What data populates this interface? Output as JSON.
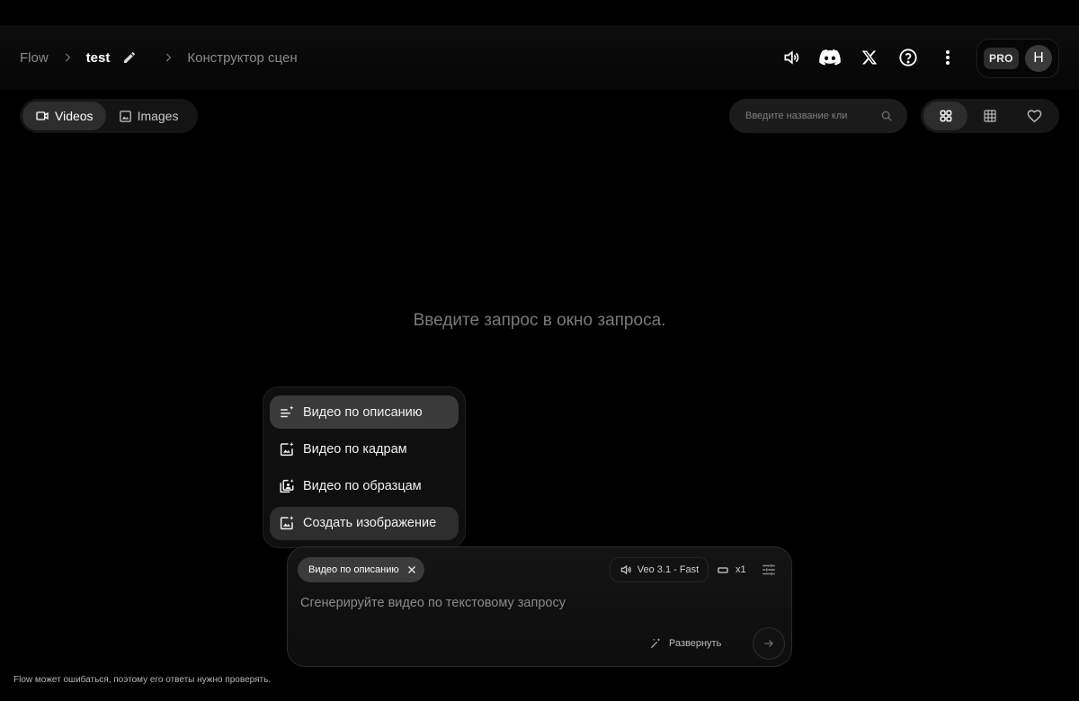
{
  "breadcrumb": {
    "root": "Flow",
    "project": "test",
    "current": "Конструктор сцен"
  },
  "header": {
    "icons": [
      "volume-icon",
      "discord-icon",
      "x-logo-icon",
      "help-icon",
      "more-vert-icon"
    ],
    "plan_badge": "PRO",
    "avatar_initial": "H"
  },
  "media_tabs": [
    {
      "label": "Videos",
      "icon": "videocam-icon",
      "active": true
    },
    {
      "label": "Images",
      "icon": "image-icon",
      "active": false
    }
  ],
  "search": {
    "placeholder": "Введите название кли"
  },
  "view_modes": [
    "grid-large-icon",
    "grid-small-icon",
    "favorite-icon"
  ],
  "empty_state": "Введите запрос в окно запроса.",
  "mode_menu": {
    "items": [
      {
        "label": "Видео по описанию",
        "icon": "text-sparkle-icon",
        "state": "active"
      },
      {
        "label": "Видео по кадрам",
        "icon": "image-sparkle-icon",
        "state": ""
      },
      {
        "label": "Видео по образцам",
        "icon": "ingredients-sparkle-icon",
        "state": ""
      },
      {
        "label": "Создать изображение",
        "icon": "image-sparkle-icon",
        "state": "hover"
      }
    ]
  },
  "composer": {
    "mode_chip": "Видео по описанию",
    "model": "Veo 3.1 - Fast",
    "count": "x1",
    "prompt_placeholder": "Сгенерируйте видео по текстовому запросу",
    "expand_label": "Развернуть"
  },
  "footer": {
    "disclaimer": "Flow может ошибаться, поэтому его ответы нужно проверять."
  }
}
